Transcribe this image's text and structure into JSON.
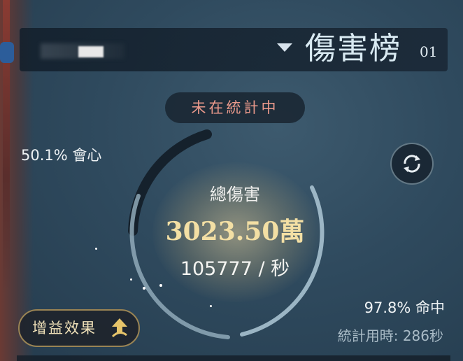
{
  "header": {
    "title": "傷害榜",
    "index": "01"
  },
  "status": {
    "label": "未在統計中"
  },
  "stats": {
    "crit": "50.1% 會心",
    "total_damage_label": "總傷害",
    "total_damage_value": "3023.50萬",
    "dps": "105777 / 秒",
    "hit": "97.8% 命中",
    "duration": "統計用時: 286秒"
  },
  "buttons": {
    "buff": "增益效果"
  },
  "icons": {
    "dropdown": "chevron-down-icon",
    "refresh": "refresh-icon",
    "buff": "up-arrow-swirl-icon"
  },
  "colors": {
    "status_text": "#ec9a8c",
    "total_value": "#f3dfa4",
    "buff_border": "#9a8454"
  }
}
